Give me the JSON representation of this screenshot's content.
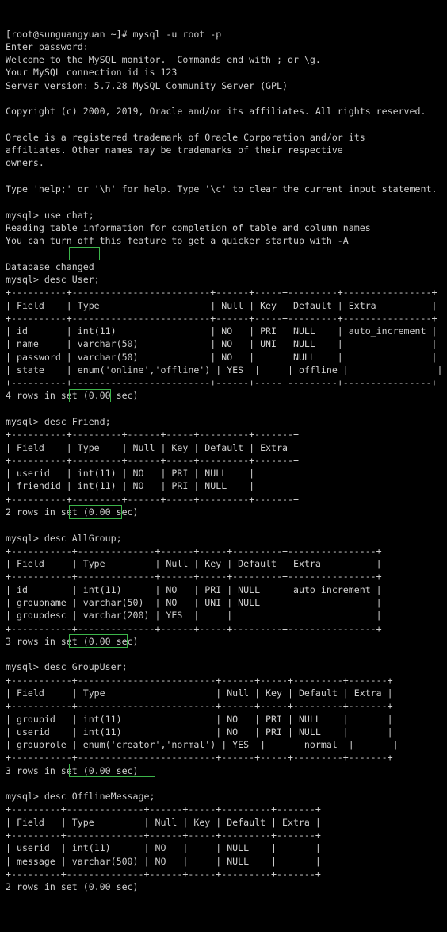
{
  "terminal": {
    "shell_prompt": "[root@sunguangyuan ~]# ",
    "shell_command": "mysql -u root -p",
    "password_prompt": "Enter password:",
    "welcome": "Welcome to the MySQL monitor.  Commands end with ; or \\g.",
    "connection_id_line": "Your MySQL connection id is 123",
    "server_version_line": "Server version: 5.7.28 MySQL Community Server (GPL)",
    "copyright_line": "Copyright (c) 2000, 2019, Oracle and/or its affiliates. All rights reserved.",
    "trademark_line_1": "Oracle is a registered trademark of Oracle Corporation and/or its",
    "trademark_line_2": "affiliates. Other names may be trademarks of their respective",
    "trademark_line_3": "owners.",
    "help_line": "Type 'help;' or '\\h' for help. Type '\\c' to clear the current input statement.",
    "mysql_prompt": "mysql> ",
    "use_command": "use chat;",
    "reading_table_info_line": "Reading table information for completion of table and column names",
    "turn_off_feature_line": "You can turn off this feature to get a quicker startup with -A",
    "database_changed_line": "Database changed",
    "desc_keyword": "desc ",
    "background_color": "#000000",
    "text_color": "#cfcfcf",
    "highlight_color": "#3cb54a"
  },
  "describes": [
    {
      "table_name": "User;",
      "columns": [
        "Field",
        "Type",
        "Null",
        "Key",
        "Default",
        "Extra"
      ],
      "widths": [
        8,
        23,
        4,
        3,
        7,
        14
      ],
      "rows": [
        [
          "id",
          "int(11)",
          "NO",
          "PRI",
          "NULL",
          "auto_increment"
        ],
        [
          "name",
          "varchar(50)",
          "NO",
          "UNI",
          "NULL",
          ""
        ],
        [
          "password",
          "varchar(50)",
          "NO",
          "",
          "NULL",
          ""
        ],
        [
          "state",
          "enum('online','offline')",
          "YES",
          "",
          "offline",
          ""
        ]
      ],
      "result_line": "4 rows in set (0.00 sec)"
    },
    {
      "table_name": "Friend;",
      "columns": [
        "Field",
        "Type",
        "Null",
        "Key",
        "Default",
        "Extra"
      ],
      "widths": [
        8,
        7,
        4,
        3,
        7,
        5
      ],
      "rows": [
        [
          "userid",
          "int(11)",
          "NO",
          "PRI",
          "NULL",
          ""
        ],
        [
          "friendid",
          "int(11)",
          "NO",
          "PRI",
          "NULL",
          ""
        ]
      ],
      "result_line": "2 rows in set (0.00 sec)"
    },
    {
      "table_name": "AllGroup;",
      "columns": [
        "Field",
        "Type",
        "Null",
        "Key",
        "Default",
        "Extra"
      ],
      "widths": [
        9,
        12,
        4,
        3,
        7,
        14
      ],
      "rows": [
        [
          "id",
          "int(11)",
          "NO",
          "PRI",
          "NULL",
          "auto_increment"
        ],
        [
          "groupname",
          "varchar(50)",
          "NO",
          "UNI",
          "NULL",
          ""
        ],
        [
          "groupdesc",
          "varchar(200)",
          "YES",
          "",
          "",
          ""
        ]
      ],
      "result_line": "3 rows in set (0.00 sec)"
    },
    {
      "table_name": "GroupUser;",
      "columns": [
        "Field",
        "Type",
        "Null",
        "Key",
        "Default",
        "Extra"
      ],
      "widths": [
        9,
        23,
        4,
        3,
        7,
        5
      ],
      "rows": [
        [
          "groupid",
          "int(11)",
          "NO",
          "PRI",
          "NULL",
          ""
        ],
        [
          "userid",
          "int(11)",
          "NO",
          "PRI",
          "NULL",
          ""
        ],
        [
          "grouprole",
          "enum('creator','normal')",
          "YES",
          "",
          "normal",
          ""
        ]
      ],
      "result_line": "3 rows in set (0.00 sec)"
    },
    {
      "table_name": "OfflineMessage;",
      "columns": [
        "Field",
        "Type",
        "Null",
        "Key",
        "Default",
        "Extra"
      ],
      "widths": [
        7,
        12,
        4,
        3,
        7,
        5
      ],
      "rows": [
        [
          "userid",
          "int(11)",
          "NO",
          "",
          "NULL",
          ""
        ],
        [
          "message",
          "varchar(500)",
          "NO",
          "",
          "NULL",
          ""
        ]
      ],
      "result_line": "2 rows in set (0.00 sec)"
    }
  ]
}
